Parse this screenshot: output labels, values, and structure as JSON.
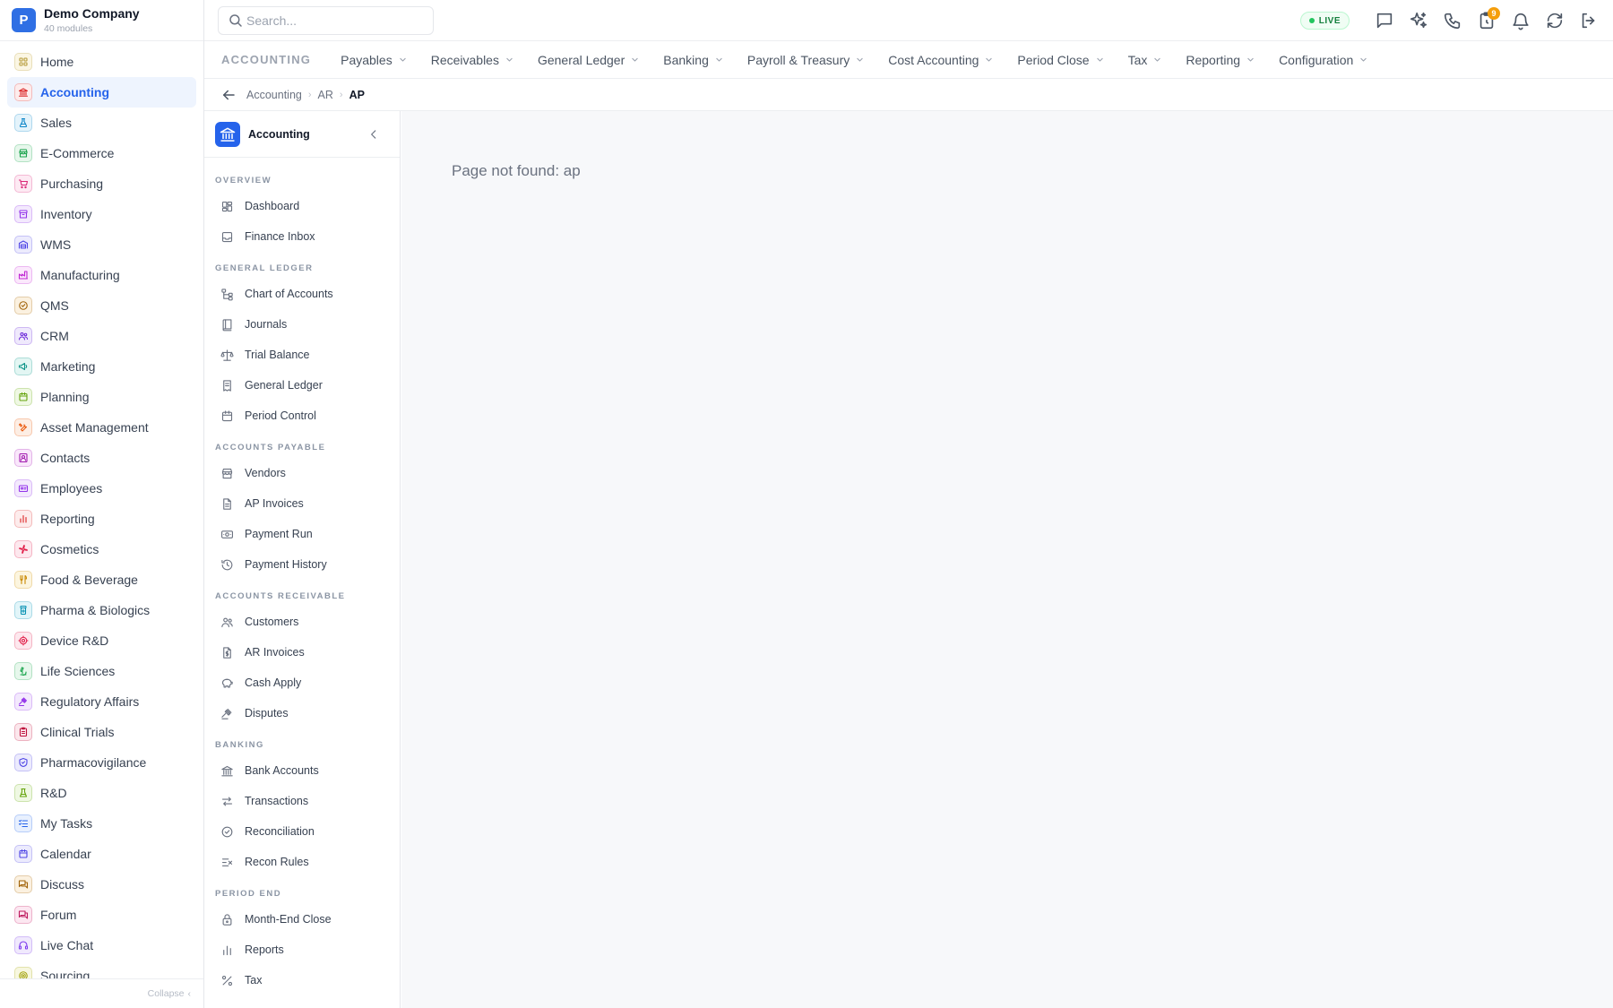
{
  "company": {
    "logo_letter": "P",
    "name": "Demo Company",
    "subtitle": "40 modules"
  },
  "modules": [
    {
      "label": "Home",
      "icon": "grid-icon",
      "color": "#b59a38",
      "bg": "#fbf6e4",
      "active": false
    },
    {
      "label": "Accounting",
      "icon": "bank-icon",
      "color": "#dc2626",
      "bg": "#fdecec",
      "active": true
    },
    {
      "label": "Sales",
      "icon": "flask-icon",
      "color": "#0e86c8",
      "bg": "#e4f3fb",
      "active": false
    },
    {
      "label": "E-Commerce",
      "icon": "store-icon",
      "color": "#16a34a",
      "bg": "#e7f7ec",
      "active": false
    },
    {
      "label": "Purchasing",
      "icon": "cart-icon",
      "color": "#db2777",
      "bg": "#fdeaf3",
      "active": false
    },
    {
      "label": "Inventory",
      "icon": "box-icon",
      "color": "#9333ea",
      "bg": "#f3e9fd",
      "active": false
    },
    {
      "label": "WMS",
      "icon": "warehouse-icon",
      "color": "#4f46e5",
      "bg": "#ecebfd",
      "active": false
    },
    {
      "label": "Manufacturing",
      "icon": "factory-icon",
      "color": "#c026d3",
      "bg": "#fbe8fc",
      "active": false
    },
    {
      "label": "QMS",
      "icon": "badge-check-icon",
      "color": "#a16207",
      "bg": "#fbf1e0",
      "active": false
    },
    {
      "label": "CRM",
      "icon": "users-icon",
      "color": "#6d28d9",
      "bg": "#efe9fc",
      "active": false
    },
    {
      "label": "Marketing",
      "icon": "megaphone-icon",
      "color": "#0d9488",
      "bg": "#e3f6f3",
      "active": false
    },
    {
      "label": "Planning",
      "icon": "calendar-icon",
      "color": "#65a30d",
      "bg": "#eff8e3",
      "active": false
    },
    {
      "label": "Asset Management",
      "icon": "tools-icon",
      "color": "#ea580c",
      "bg": "#fdeee4",
      "active": false
    },
    {
      "label": "Contacts",
      "icon": "contact-icon",
      "color": "#a21caf",
      "bg": "#f9e7fb",
      "active": false
    },
    {
      "label": "Employees",
      "icon": "id-card-icon",
      "color": "#9333ea",
      "bg": "#f3e9fd",
      "active": false
    },
    {
      "label": "Reporting",
      "icon": "bar-chart-icon",
      "color": "#dc2626",
      "bg": "#fdecec",
      "active": false
    },
    {
      "label": "Cosmetics",
      "icon": "flower-icon",
      "color": "#e11d48",
      "bg": "#fde8ee",
      "active": false
    },
    {
      "label": "Food & Beverage",
      "icon": "utensils-icon",
      "color": "#ca8a04",
      "bg": "#fcf5df",
      "active": false
    },
    {
      "label": "Pharma & Biologics",
      "icon": "pill-bottle-icon",
      "color": "#0891b2",
      "bg": "#e2f5f9",
      "active": false
    },
    {
      "label": "Device R&D",
      "icon": "cog-icon",
      "color": "#e11d48",
      "bg": "#fde8ee",
      "active": false
    },
    {
      "label": "Life Sciences",
      "icon": "microscope-icon",
      "color": "#16a34a",
      "bg": "#e7f7ec",
      "active": false
    },
    {
      "label": "Regulatory Affairs",
      "icon": "gavel-icon",
      "color": "#9333ea",
      "bg": "#f3e9fd",
      "active": false
    },
    {
      "label": "Clinical Trials",
      "icon": "clipboard-icon",
      "color": "#be123c",
      "bg": "#fbe7ec",
      "active": false
    },
    {
      "label": "Pharmacovigilance",
      "icon": "shield-icon",
      "color": "#4f46e5",
      "bg": "#ecebfd",
      "active": false
    },
    {
      "label": "R&D",
      "icon": "beaker-icon",
      "color": "#65a30d",
      "bg": "#eff8e3",
      "active": false
    },
    {
      "label": "My Tasks",
      "icon": "list-check-icon",
      "color": "#2563eb",
      "bg": "#e8f0fe",
      "active": false
    },
    {
      "label": "Calendar",
      "icon": "calendar-icon",
      "color": "#4f46e5",
      "bg": "#ecebfd",
      "active": false
    },
    {
      "label": "Discuss",
      "icon": "chat-icon",
      "color": "#a16207",
      "bg": "#fbf1e0",
      "active": false
    },
    {
      "label": "Forum",
      "icon": "chat-icon",
      "color": "#be185d",
      "bg": "#fce7f1",
      "active": false
    },
    {
      "label": "Live Chat",
      "icon": "headset-icon",
      "color": "#7c3aed",
      "bg": "#f0e9fd",
      "active": false
    },
    {
      "label": "Sourcing",
      "icon": "target-icon",
      "color": "#a3a30d",
      "bg": "#f7f7e0",
      "active": false
    }
  ],
  "sidebar_footer": {
    "collapse_label": "Collapse",
    "collapse_arrow": "‹"
  },
  "search": {
    "placeholder": "Search...",
    "value": ""
  },
  "topbar": {
    "live_label": "LIVE",
    "notification_count": "9",
    "live_color": "#22c55e"
  },
  "module_nav": {
    "title": "ACCOUNTING",
    "tabs": [
      "Payables",
      "Receivables",
      "General Ledger",
      "Banking",
      "Payroll & Treasury",
      "Cost Accounting",
      "Period Close",
      "Tax",
      "Reporting",
      "Configuration"
    ]
  },
  "breadcrumb": {
    "items": [
      "Accounting",
      "AR"
    ],
    "current": "AP",
    "separator": "›"
  },
  "subnav": {
    "title": "Accounting",
    "sections": [
      {
        "label": "OVERVIEW",
        "items": [
          {
            "label": "Dashboard",
            "icon": "dashboard-icon"
          },
          {
            "label": "Finance Inbox",
            "icon": "inbox-icon"
          }
        ]
      },
      {
        "label": "GENERAL LEDGER",
        "items": [
          {
            "label": "Chart of Accounts",
            "icon": "hierarchy-icon"
          },
          {
            "label": "Journals",
            "icon": "book-icon"
          },
          {
            "label": "Trial Balance",
            "icon": "scale-icon"
          },
          {
            "label": "General Ledger",
            "icon": "ledger-icon"
          },
          {
            "label": "Period Control",
            "icon": "calendar-icon"
          }
        ]
      },
      {
        "label": "ACCOUNTS PAYABLE",
        "items": [
          {
            "label": "Vendors",
            "icon": "store-icon"
          },
          {
            "label": "AP Invoices",
            "icon": "file-icon"
          },
          {
            "label": "Payment Run",
            "icon": "banknote-icon"
          },
          {
            "label": "Payment History",
            "icon": "history-icon"
          }
        ]
      },
      {
        "label": "ACCOUNTS RECEIVABLE",
        "items": [
          {
            "label": "Customers",
            "icon": "users-icon"
          },
          {
            "label": "AR Invoices",
            "icon": "invoice-icon"
          },
          {
            "label": "Cash Apply",
            "icon": "piggy-bank-icon"
          },
          {
            "label": "Disputes",
            "icon": "gavel-icon"
          }
        ]
      },
      {
        "label": "BANKING",
        "items": [
          {
            "label": "Bank Accounts",
            "icon": "bank-icon"
          },
          {
            "label": "Transactions",
            "icon": "arrows-icon"
          },
          {
            "label": "Reconciliation",
            "icon": "check-circle-icon"
          },
          {
            "label": "Recon Rules",
            "icon": "rules-icon"
          }
        ]
      },
      {
        "label": "PERIOD END",
        "items": [
          {
            "label": "Month-End Close",
            "icon": "lock-icon"
          },
          {
            "label": "Reports",
            "icon": "bar-chart-icon"
          },
          {
            "label": "Tax",
            "icon": "percent-icon"
          }
        ]
      }
    ]
  },
  "main": {
    "message": "Page not found: ap"
  }
}
